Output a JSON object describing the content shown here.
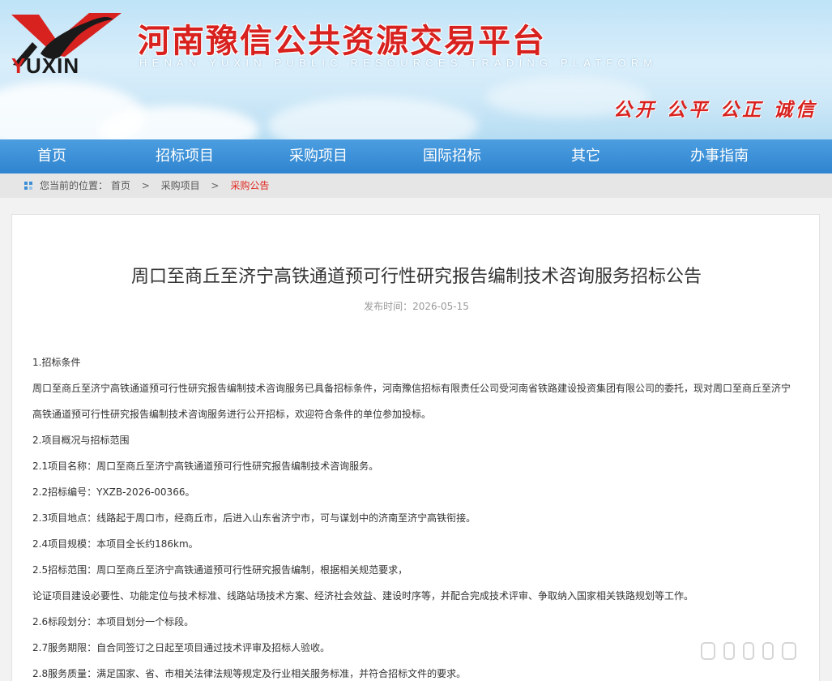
{
  "header": {
    "logo_text": "YUXIN",
    "title": "河南豫信公共资源交易平台",
    "subtitle": "HENAN YUXIN PUBLIC RESOURCES TRADING PLATFORM",
    "slogan": "公开 公平 公正 诚信"
  },
  "nav": {
    "items": [
      {
        "label": "首页"
      },
      {
        "label": "招标项目"
      },
      {
        "label": "采购项目"
      },
      {
        "label": "国际招标"
      },
      {
        "label": "其它"
      },
      {
        "label": "办事指南"
      }
    ]
  },
  "breadcrumb": {
    "prefix": "您当前的位置：",
    "home": "首页",
    "separator": ">",
    "section": "采购项目",
    "current": "采购公告"
  },
  "article": {
    "title": "周口至商丘至济宁高铁通道预可行性研究报告编制技术咨询服务招标公告",
    "date": "发布时间：2026-05-15",
    "paragraphs": [
      "1.招标条件",
      "周口至商丘至济宁高铁通道预可行性研究报告编制技术咨询服务已具备招标条件，河南豫信招标有限责任公司受河南省铁路建设投资集团有限公司的委托，现对周口至商丘至济宁",
      "高铁通道预可行性研究报告编制技术咨询服务进行公开招标，欢迎符合条件的单位参加投标。",
      "2.项目概况与招标范围",
      "2.1项目名称：周口至商丘至济宁高铁通道预可行性研究报告编制技术咨询服务。",
      "2.2招标编号：YXZB-2026-00366。",
      "2.3项目地点：线路起于周口市，经商丘市，后进入山东省济宁市，可与谋划中的济南至济宁高铁衔接。",
      "2.4项目规模：本项目全长约186km。",
      "2.5招标范围：周口至商丘至济宁高铁通道预可行性研究报告编制，根据相关规范要求，",
      "论证项目建设必要性、功能定位与技术标准、线路站场技术方案、经济社会效益、建设时序等，并配合完成技术评审、争取纳入国家相关铁路规划等工作。",
      "2.6标段划分：本项目划分一个标段。",
      "2.7服务期限：自合同签订之日起至项目通过技术评审及招标人验收。",
      "2.8服务质量：满足国家、省、市相关法律法规等规定及行业相关服务标准，并符合招标文件的要求。"
    ]
  },
  "colors": {
    "brand_red": "#d8221f",
    "nav_blue": "#3b8ed6",
    "crumb_current": "#e0281f"
  }
}
